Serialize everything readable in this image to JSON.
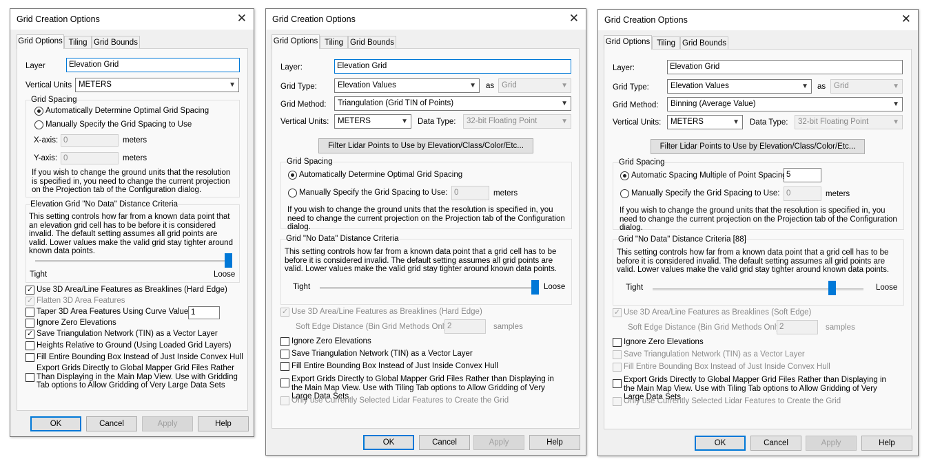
{
  "d1": {
    "title": "Grid Creation Options",
    "tabs": [
      "Grid Options",
      "Tiling",
      "Grid Bounds"
    ],
    "layer_label": "Layer",
    "layer_value": "Elevation Grid",
    "vunits_label": "Vertical Units",
    "vunits_value": "METERS",
    "spacing_group": "Grid Spacing",
    "spacing_auto": "Automatically Determine Optimal Grid Spacing",
    "spacing_manual": "Manually Specify the Grid Spacing to Use",
    "xaxis_label": "X-axis:",
    "xaxis_value": "0",
    "xaxis_unit": "meters",
    "yaxis_label": "Y-axis:",
    "yaxis_value": "0",
    "yaxis_unit": "meters",
    "spacing_note": "If you wish to change the ground units that the resolution is specified in, you need to change the current projection on the Projection tab of the Configuration dialog.",
    "nodata_group": "Elevation Grid \"No Data\" Distance Criteria",
    "nodata_desc": "This setting controls how far from a known data point that an elevation grid cell has to be before it is considered invalid. The default setting assumes all grid points are valid. Lower values make the valid grid stay tighter around known data points.",
    "slider_level": 1.0,
    "tight": "Tight",
    "loose": "Loose",
    "checks": [
      "Use 3D Area/Line Features as Breaklines (Hard Edge)",
      "Flatten 3D Area Features",
      "Taper 3D Area Features Using Curve Value:",
      "Ignore Zero Elevations",
      "Save Triangulation Network (TIN) as a Vector Layer",
      "Heights Relative to Ground (Using Loaded Grid Layers)",
      "Fill Entire Bounding Box Instead of Just Inside Convex Hull",
      "Export Grids Directly to Global Mapper Grid Files Rather Than Displaying in the Main Map View. Use with Gridding Tab options to Allow Gridding of Very Large Data Sets"
    ],
    "taper_value": "1",
    "buttons": [
      "OK",
      "Cancel",
      "Apply",
      "Help"
    ]
  },
  "d2": {
    "title": "Grid Creation Options",
    "tabs": [
      "Grid Options",
      "Tiling",
      "Grid Bounds"
    ],
    "layer_label": "Layer:",
    "layer_value": "Elevation Grid",
    "gridtype_label": "Grid Type:",
    "gridtype_value": "Elevation Values",
    "as_label": "as",
    "as_value": "Grid",
    "method_label": "Grid Method:",
    "method_value": "Triangulation (Grid TIN of Points)",
    "vunits_label": "Vertical Units:",
    "vunits_value": "METERS",
    "dtype_label": "Data Type:",
    "dtype_value": "32-bit Floating Point",
    "filter_button": "Filter Lidar Points to Use by Elevation/Class/Color/Etc...",
    "spacing_group": "Grid Spacing",
    "spacing_auto": "Automatically Determine Optimal Grid Spacing",
    "spacing_manual": "Manually Specify the Grid Spacing to Use:",
    "manual_value": "0",
    "manual_unit": "meters",
    "spacing_note": "If you wish to change the ground units that the resolution is specified in, you need to change the current projection on the Projection tab of the Configuration dialog.",
    "nodata_group": "Grid \"No Data\" Distance Criteria",
    "nodata_desc": "This setting controls how far from a known data point that a grid cell has to be before it is considered invalid. The default setting assumes all grid points are valid. Lower values make the valid grid stay tighter around known data points.",
    "slider_level": 1.0,
    "tight": "Tight",
    "loose": "Loose",
    "breaklines": "Use 3D Area/Line Features as Breaklines (Hard Edge)",
    "soft_label": "Soft Edge Distance (Bin Grid Methods Only):",
    "soft_value": "2",
    "soft_unit": "samples",
    "checks": [
      "Ignore Zero Elevations",
      "Save Triangulation Network (TIN) as a Vector Layer",
      "Fill Entire Bounding Box Instead of Just Inside Convex Hull",
      "Export Grids Directly to Global Mapper Grid Files Rather than Displaying in the Main Map View. Use with Tiling Tab options to Allow Gridding of Very Large Data Sets",
      "Only use Currently Selected Lidar Features to Create the Grid"
    ],
    "buttons": [
      "OK",
      "Cancel",
      "Apply",
      "Help"
    ]
  },
  "d3": {
    "title": "Grid Creation Options",
    "tabs": [
      "Grid Options",
      "Tiling",
      "Grid Bounds"
    ],
    "layer_label": "Layer:",
    "layer_value": "Elevation Grid",
    "gridtype_label": "Grid Type:",
    "gridtype_value": "Elevation Values",
    "as_label": "as",
    "as_value": "Grid",
    "method_label": "Grid Method:",
    "method_value": "Binning (Average Value)",
    "vunits_label": "Vertical Units:",
    "vunits_value": "METERS",
    "dtype_label": "Data Type:",
    "dtype_value": "32-bit Floating Point",
    "filter_button": "Filter Lidar Points to Use by Elevation/Class/Color/Etc...",
    "spacing_group": "Grid Spacing",
    "spacing_auto": "Automatic Spacing Multiple of Point Spacing:",
    "auto_value": "5",
    "spacing_manual": "Manually Specify the Grid Spacing to Use:",
    "manual_value": "0",
    "manual_unit": "meters",
    "spacing_note": "If you wish to change the ground units that the resolution is specified in, you need to change the current projection on the Projection tab of the Configuration dialog.",
    "nodata_group": "Grid \"No Data\" Distance Criteria [88]",
    "nodata_desc": "This setting controls how far from a known data point that a grid cell has to be before it is considered invalid. The default setting assumes all grid points are valid. Lower values make the valid grid stay tighter around known data points.",
    "slider_level": 0.85,
    "tight": "Tight",
    "loose": "Loose",
    "breaklines": "Use 3D Area/Line Features as Breaklines (Soft Edge)",
    "soft_label": "Soft Edge Distance (Bin Grid Methods Only):",
    "soft_value": "2",
    "soft_unit": "samples",
    "checks": [
      "Ignore Zero Elevations",
      "Save Triangulation Network (TIN) as a Vector Layer",
      "Fill Entire Bounding Box Instead of Just Inside Convex Hull",
      "Export Grids Directly to Global Mapper Grid Files Rather than Displaying in the Main Map View. Use with Tiling Tab options to Allow Gridding of Very Large Data Sets",
      "Only use Currently Selected Lidar Features to Create the Grid"
    ],
    "buttons": [
      "OK",
      "Cancel",
      "Apply",
      "Help"
    ]
  }
}
